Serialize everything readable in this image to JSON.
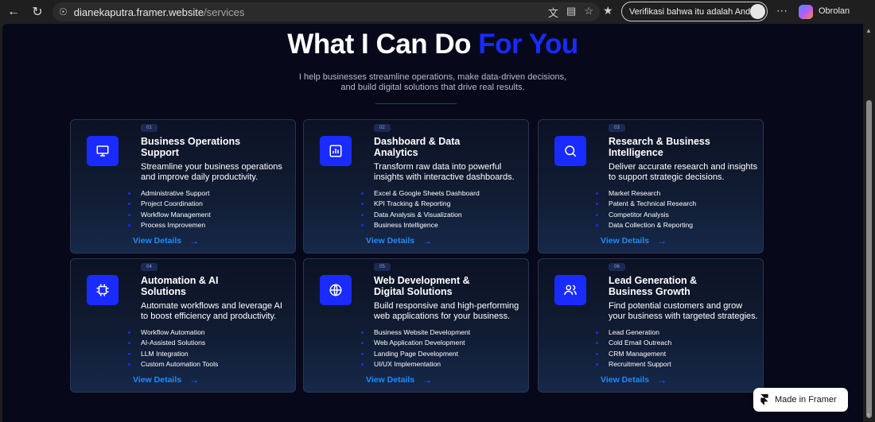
{
  "browser": {
    "url_host": "dianekaputra.framer.website",
    "url_path": "/services",
    "profile_text": "Verifikasi bahwa itu adalah Anda",
    "copilot_label": "Obrolan"
  },
  "hero": {
    "title_main": "What I Can Do",
    "title_accent": "For You",
    "subtitle_line1": "I help businesses streamline operations, make data-driven decisions,",
    "subtitle_line2": "and build digital solutions that drive real results."
  },
  "cards": [
    {
      "num": "01",
      "icon": "monitor-icon",
      "title_line1": "Business Operations",
      "title_line2": "Support",
      "desc_line1": "Streamline your business operations",
      "desc_line2": "and improve daily productivity.",
      "items": [
        "Administrative Support",
        "Project Coordination",
        "Workflow Management",
        "Process Improvemen"
      ],
      "cta": "View Details"
    },
    {
      "num": "02",
      "icon": "bar-chart-icon",
      "title_line1": "Dashboard & Data",
      "title_line2": "Analytics",
      "desc_line1": "Transform raw data into powerful",
      "desc_line2": "insights with interactive dashboards.",
      "items": [
        "Excel & Google Sheets Dashboard",
        "KPI Tracking & Reporting",
        "Data Analysis & Visualization",
        "Business Intelligence"
      ],
      "cta": "View Details"
    },
    {
      "num": "03",
      "icon": "search-icon",
      "title_line1": "Research & Business",
      "title_line2": "Intelligence",
      "desc_line1": "Deliver accurate research and insights",
      "desc_line2": "to support strategic decisions.",
      "items": [
        "Market Research",
        "Patent & Technical Research",
        "Competitor Analysis",
        "Data Collection & Reporting"
      ],
      "cta": "View Details"
    },
    {
      "num": "04",
      "icon": "cpu-chip-icon",
      "title_line1": "Automation & AI",
      "title_line2": "Solutions",
      "desc_line1": "Automate workflows and leverage AI",
      "desc_line2": "to boost efficiency and productivity.",
      "items": [
        "Workflow Automation",
        "AI-Assisted Solutions",
        "LLM Integration",
        "Custom Automation Tools"
      ],
      "cta": "View Details"
    },
    {
      "num": "05",
      "icon": "globe-icon",
      "title_line1": "Web Development &",
      "title_line2": "Digital Solutions",
      "desc_line1": "Build responsive and high-performing",
      "desc_line2": "web applications for your business.",
      "items": [
        "Business Website Development",
        "Web Application Development",
        "Landing Page Development",
        "UI/UX Implementation"
      ],
      "cta": "View Details"
    },
    {
      "num": "06",
      "icon": "users-icon",
      "title_line1": "Lead Generation &",
      "title_line2": "Business Growth",
      "desc_line1": "Find potential customers and grow",
      "desc_line2": "your business with targeted strategies.",
      "items": [
        "Lead Generation",
        "Cold Email Outreach",
        "CRM Management",
        "Recruitment Support"
      ],
      "cta": "View Details"
    }
  ],
  "badge": {
    "label": "Made in Framer"
  }
}
